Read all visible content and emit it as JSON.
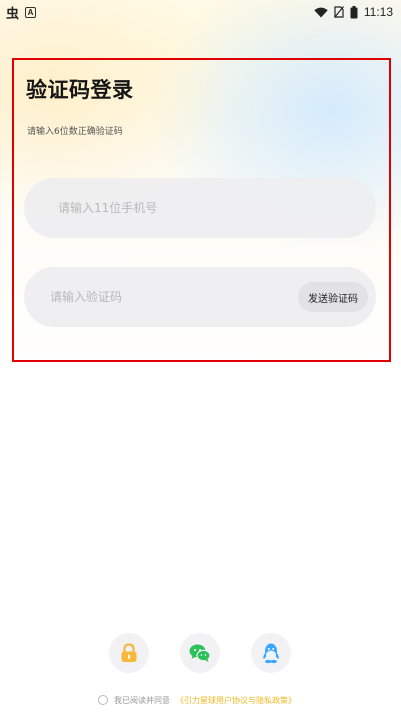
{
  "status_bar": {
    "left_glyph": "虫",
    "notification_badge": "A",
    "time": "11:13",
    "icons": [
      "wifi-icon",
      "no-sim-icon",
      "battery-icon"
    ]
  },
  "login": {
    "title": "验证码登录",
    "subtitle": "请输入6位数正确验证码",
    "phone_placeholder": "请输入11位手机号",
    "code_placeholder": "请输入验证码",
    "send_code_label": "发送验证码"
  },
  "social": {
    "buttons": [
      {
        "icon": "lock-icon",
        "color": "#f6b93b"
      },
      {
        "icon": "wechat-icon",
        "color": "#2dc15c"
      },
      {
        "icon": "qq-icon",
        "color": "#39a7ff"
      }
    ]
  },
  "agreement": {
    "prefix": "我已阅读并同意",
    "link": "《引力星球用户协议与隐私政策》",
    "checked": false
  },
  "colors": {
    "highlight_frame": "#e00000",
    "agreement_link": "#f0b820"
  }
}
